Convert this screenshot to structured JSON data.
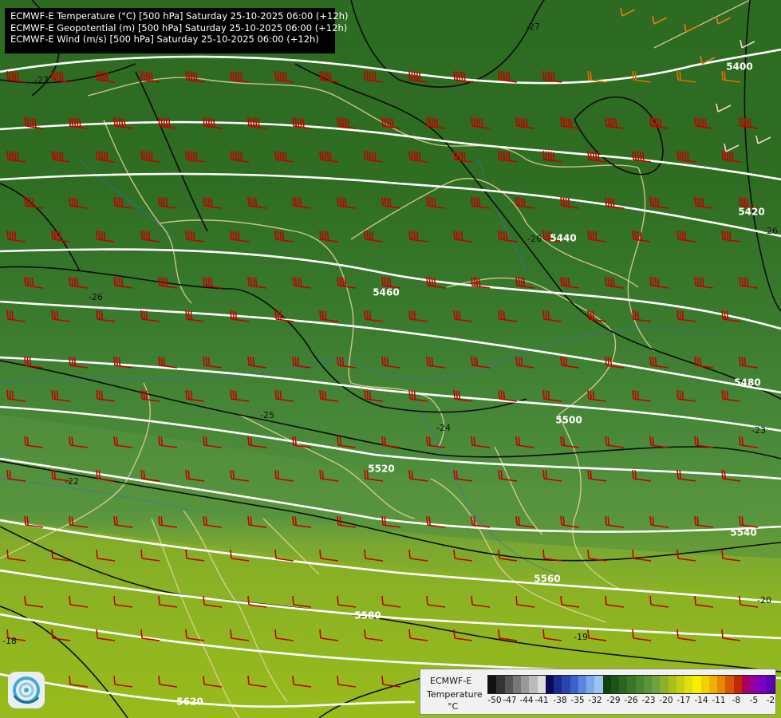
{
  "header": {
    "lines": [
      "ECMWF-E Temperature (°C) [500 hPa] Saturday 25-10-2025 06:00 (+12h)",
      "ECMWF-E Geopotential (m) [500 hPa] Saturday 25-10-2025 06:00 (+12h)",
      "ECMWF-E Wind (m/s) [500 hPa] Saturday 25-10-2025 06:00 (+12h)"
    ]
  },
  "legend": {
    "model": "ECMWF-E",
    "variable": "Temperature",
    "unit": "°C",
    "ticks": [
      "-50",
      "-47",
      "-44",
      "-41",
      "-38",
      "-35",
      "-32",
      "-29",
      "-26",
      "-23",
      "-20",
      "-17",
      "-14",
      "-11",
      "-8",
      "-5",
      "-2"
    ],
    "colors": [
      "#111111",
      "#333333",
      "#555555",
      "#777777",
      "#999999",
      "#bbbbbb",
      "#dddddd",
      "#0a0a5a",
      "#1c2a8c",
      "#2b44b0",
      "#3a63cf",
      "#5a88e0",
      "#7ca8ea",
      "#9cc4f0",
      "#0f4210",
      "#1c5518",
      "#2a6620",
      "#3a7528",
      "#4a8530",
      "#5a933a",
      "#6ea140",
      "#8cb02a",
      "#a8c018",
      "#c4d010",
      "#e0e010",
      "#f4f000",
      "#f4d000",
      "#f0b000",
      "#e88800",
      "#d85a00",
      "#c02a00",
      "#a80060",
      "#9000a0",
      "#7a00c8",
      "#5a00b0"
    ]
  },
  "map": {
    "geopotential_labels": [
      {
        "value": "5400"
      },
      {
        "value": "5420"
      },
      {
        "value": "5440"
      },
      {
        "value": "5460"
      },
      {
        "value": "5480"
      },
      {
        "value": "5500"
      },
      {
        "value": "5520"
      },
      {
        "value": "5540"
      },
      {
        "value": "5560"
      },
      {
        "value": "5580"
      },
      {
        "value": "5620"
      }
    ],
    "temperature_labels": [
      {
        "value": "-27"
      },
      {
        "value": "-27"
      },
      {
        "value": "-26"
      },
      {
        "value": "-26"
      },
      {
        "value": "-25"
      },
      {
        "value": "-24"
      },
      {
        "value": "-23"
      },
      {
        "value": "-22"
      },
      {
        "value": "-20"
      },
      {
        "value": "-19"
      },
      {
        "value": "-18"
      },
      {
        "value": "-26"
      }
    ]
  }
}
